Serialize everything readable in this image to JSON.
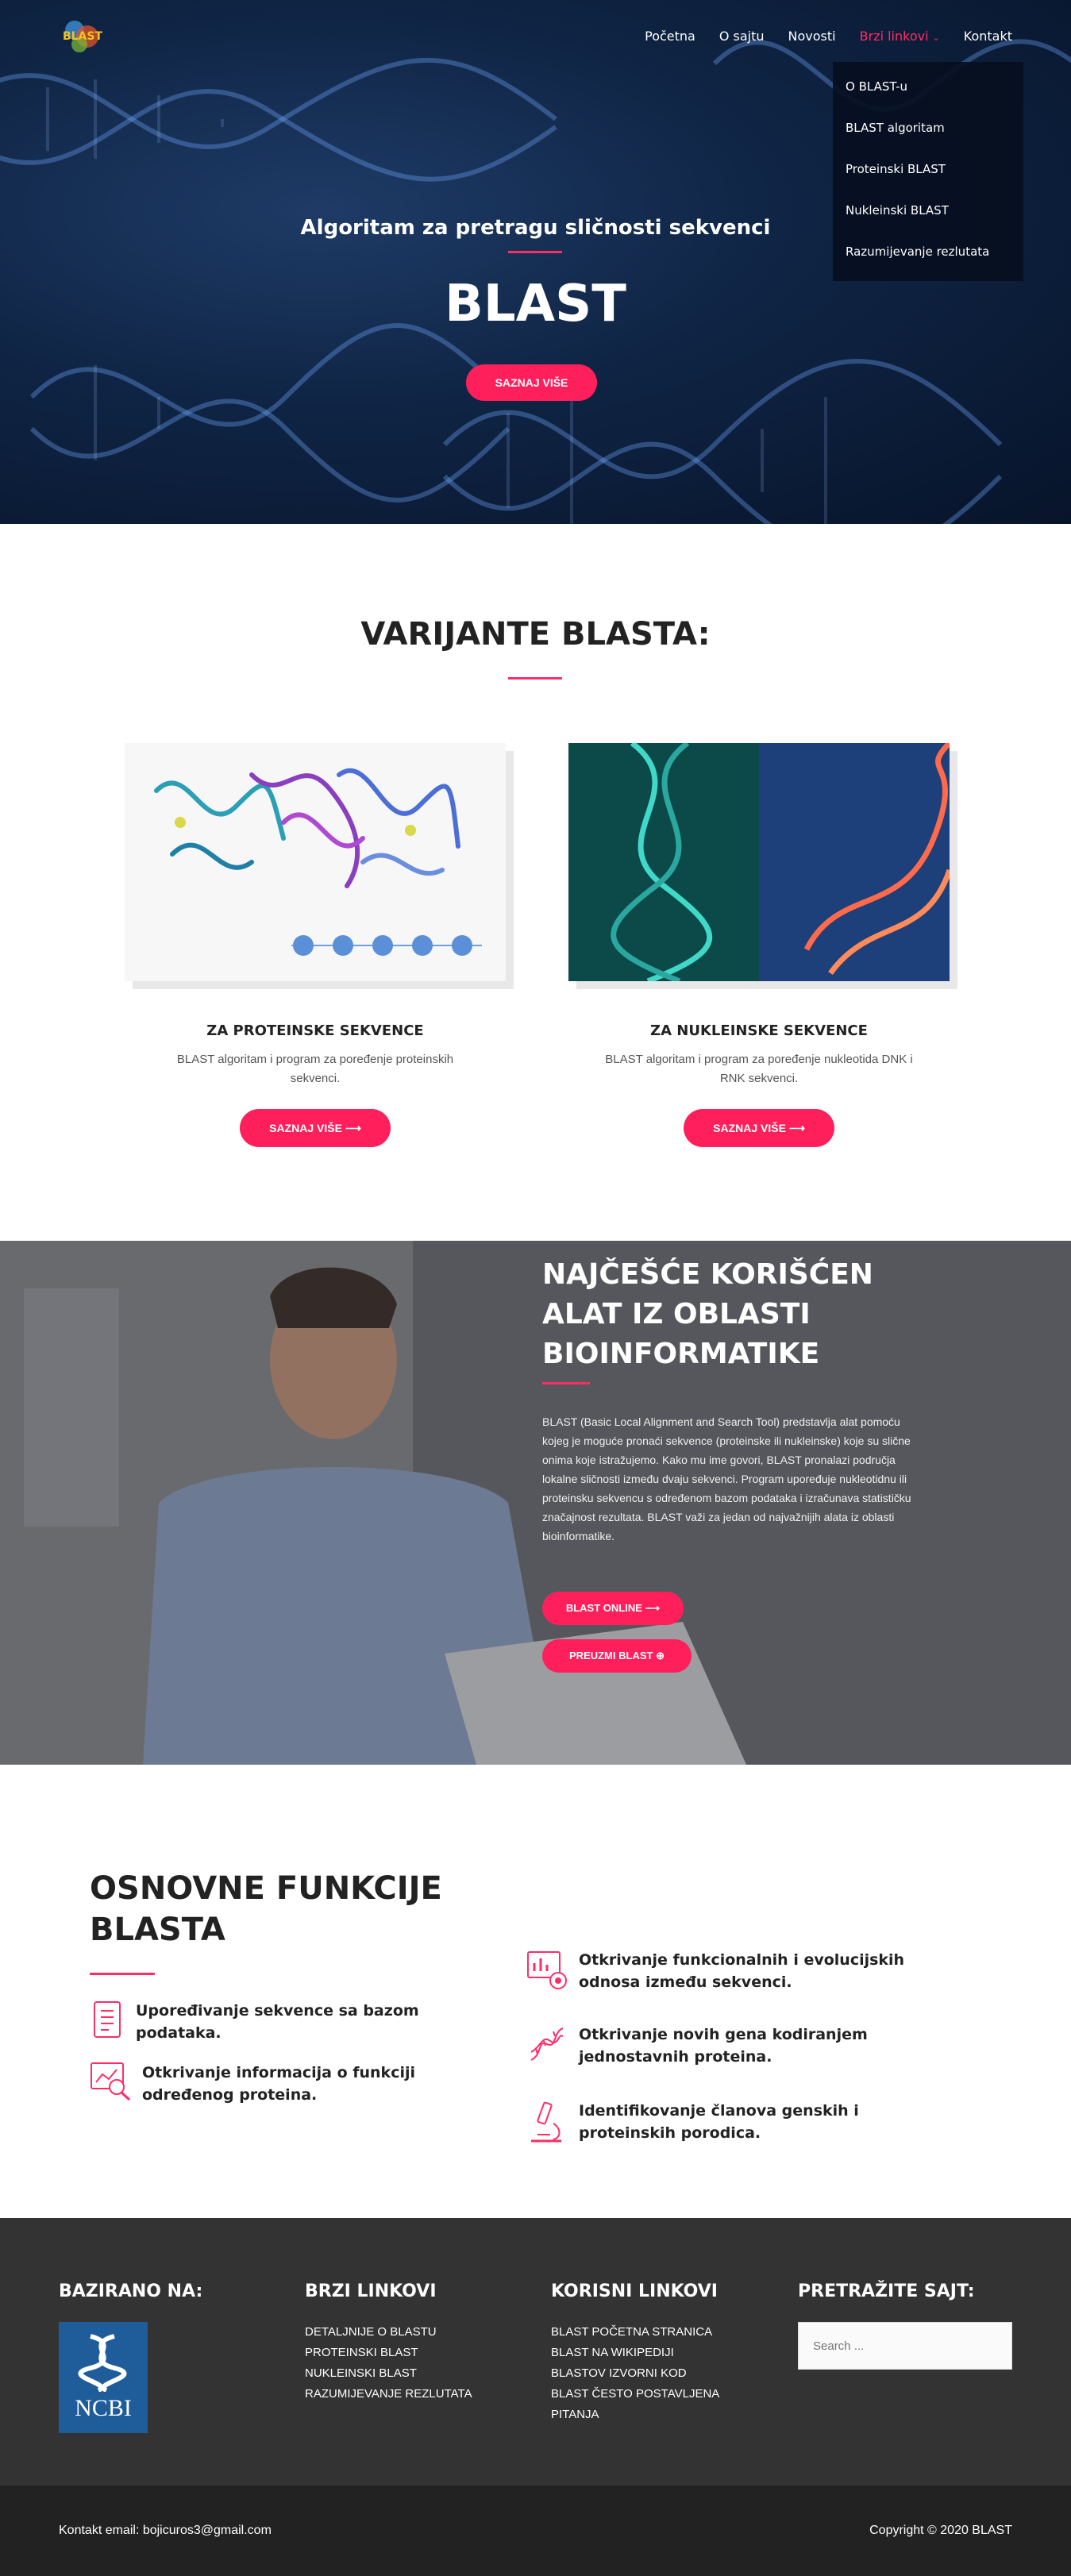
{
  "header": {
    "logo_text": "BLAST",
    "nav": [
      {
        "label": "Početna"
      },
      {
        "label": "O sajtu"
      },
      {
        "label": "Novosti"
      },
      {
        "label": "Brzi linkovi"
      },
      {
        "label": "Kontakt"
      }
    ],
    "dropdown": [
      "O BLAST-u",
      "BLAST algoritam",
      "Proteinski BLAST",
      "Nukleinski BLAST",
      "Razumijevanje rezlutata"
    ]
  },
  "hero": {
    "subtitle": "Algoritam za pretragu sličnosti sekvenci",
    "title": "BLAST",
    "button": "SAZNAJ VIŠE"
  },
  "variants": {
    "title": "VARIJANTE BLASTA:",
    "cards": [
      {
        "title": "ZA PROTEINSKE SEKVENCE",
        "text": "BLAST algoritam i program za poređenje proteinskih sekvenci.",
        "button": "SAZNAJ VIŠE"
      },
      {
        "title": "ZA NUKLEINSKE SEKVENCE",
        "text": "BLAST algoritam i program za poređenje nukleotida DNK i RNK sekvenci.",
        "button": "SAZNAJ VIŠE"
      }
    ]
  },
  "feature": {
    "title": "NAJČEŠĆE KORIŠĆEN ALAT IZ OBLASTI BIOINFORMATIKE",
    "text": "BLAST (Basic Local Alignment and Search Tool) predstavlja alat pomoću kojeg je moguće pronaći sekvence (proteinske ili nukleinske) koje su slične onima koje istražujemo. Kako mu ime govori, BLAST pronalazi područja lokalne sličnosti između dvaju sekvenci. Program upoređuje nukleotidnu ili proteinsku sekvencu s određenom bazom podataka i izračunava statističku značajnost rezultata. BLAST važi za jedan od najvažnijih alata iz oblasti bioinformatike.",
    "button_online": "BLAST ONLINE",
    "button_download": "PREUZMI BLAST"
  },
  "functions": {
    "title": "OSNOVNE FUNKCIJE BLASTA",
    "items": [
      "Upoređivanje sekvence sa bazom podataka.",
      "Otkrivanje informacija o funkciji određenog proteina.",
      "Otkrivanje funkcionalnih i evolucijskih odnosa između sekvenci.",
      "Otkrivanje novih gena kodiranjem jednostavnih proteina.",
      "Identifikovanje članova genskih i proteinskih porodica."
    ]
  },
  "footer": {
    "col1_title": "BAZIRANO NA:",
    "ncbi": "NCBI",
    "col2_title": "BRZI LINKOVI",
    "col2_links": [
      "Detaljnije o BLASTU",
      "Proteinski BLAST",
      "Nukleinski BLAST",
      "Razumijevanje rezlutata"
    ],
    "col3_title": "KORISNI LINKOVI",
    "col3_links": [
      "BLAST početna stranica",
      "BLAST na Wikipediji",
      "BLASTov izvorni kod",
      "BLAST često postavljena pitanja"
    ],
    "col4_title": "PRETRAŽITE SAJT:",
    "search_placeholder": "Search ...",
    "contact": "Kontakt email: bojicuros3@gmail.com",
    "copyright": "Copyright © 2020 BLAST"
  },
  "colors": {
    "accent": "#ff1f5a",
    "footer": "#333333",
    "bottombar": "#222222"
  }
}
